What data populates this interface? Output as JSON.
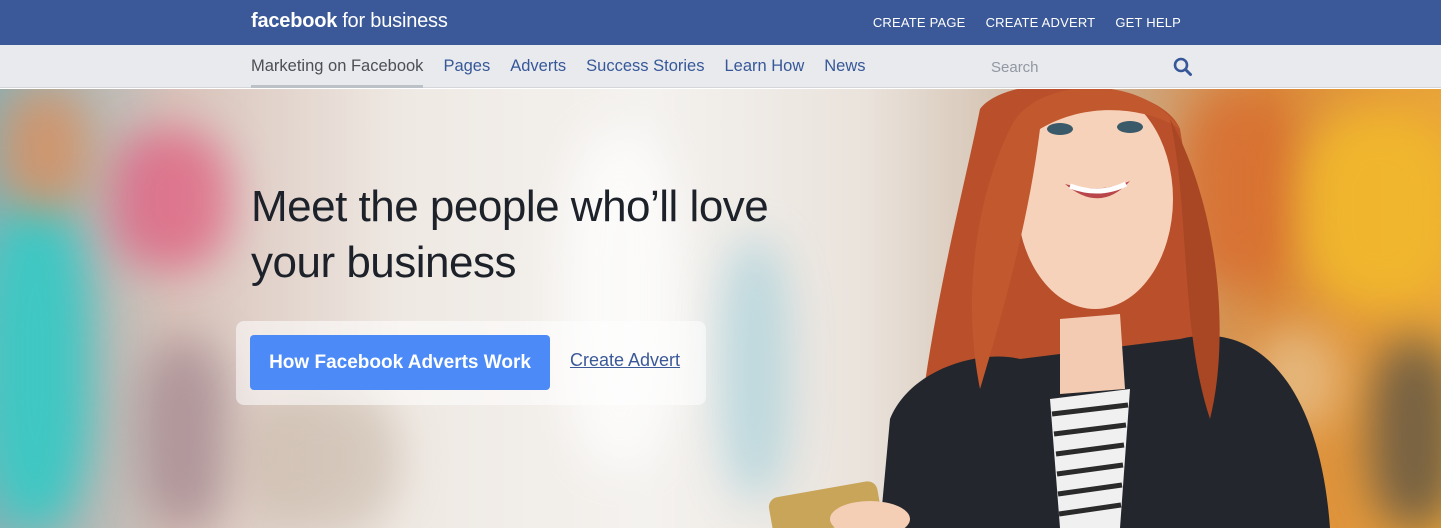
{
  "header": {
    "logo_brand": "facebook",
    "logo_suffix": "for business",
    "links": [
      "CREATE PAGE",
      "CREATE ADVERT",
      "GET HELP"
    ]
  },
  "nav": {
    "items": [
      "Marketing on Facebook",
      "Pages",
      "Adverts",
      "Success Stories",
      "Learn How",
      "News"
    ],
    "active": "Marketing on Facebook"
  },
  "search": {
    "placeholder": "Search",
    "value": ""
  },
  "hero": {
    "title": "Meet the people who’ll love your business",
    "primary_button": "How Facebook Adverts Work",
    "secondary_link": "Create Advert"
  },
  "colors": {
    "brand_blue": "#3b5998",
    "nav_bg": "#e9eaed",
    "cta_blue": "#4b8af7"
  },
  "icons": {
    "search": "search-icon"
  }
}
